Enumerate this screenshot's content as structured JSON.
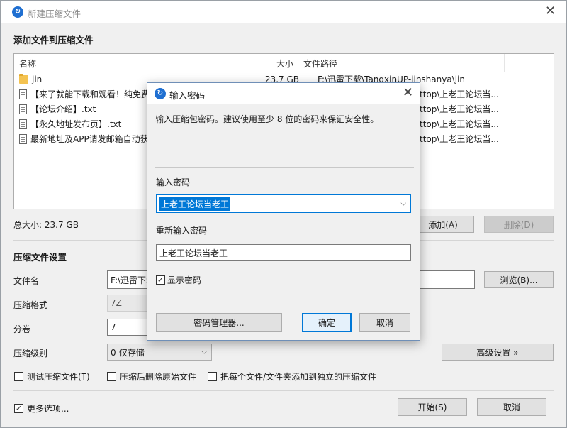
{
  "main": {
    "title": "新建压缩文件",
    "section_add": "添加文件到压缩文件",
    "list": {
      "columns": [
        "名称",
        "大小",
        "文件路径"
      ],
      "rows": [
        {
          "name": "jin",
          "size": "23.7 GB",
          "path": "F:\\迅雷下载\\TangxinUP-jinshanya\\jin",
          "icon": "folder-icon"
        },
        {
          "name": "【来了就能下载和观看！纯免费",
          "size": "",
          "path": "ttop\\上老王论坛当...",
          "icon": "text-file-icon"
        },
        {
          "name": "【论坛介绍】.txt",
          "size": "",
          "path": "ttop\\上老王论坛当...",
          "icon": "text-file-icon"
        },
        {
          "name": "【永久地址发布页】.txt",
          "size": "",
          "path": "ttop\\上老王论坛当...",
          "icon": "text-file-icon"
        },
        {
          "name": "最新地址及APP请发邮箱自动获",
          "size": "",
          "path": "ttop\\上老王论坛当...",
          "icon": "text-file-icon"
        }
      ]
    },
    "total_size": "总大小: 23.7 GB",
    "add_button": "添加(A)",
    "delete_button": "删除(D)",
    "section_settings": "压缩文件设置",
    "filename_label": "文件名",
    "filename_value": "F:\\迅雷下载",
    "browse_button": "浏览(B)...",
    "format_label": "压缩格式",
    "format_value": "7Z",
    "split_label": "分卷",
    "split_value": "7",
    "level_label": "压缩级别",
    "level_value": "0-仅存储",
    "advanced_button": "高级设置 »",
    "checkbox_test": "测试压缩文件(T)",
    "checkbox_delete_original": "压缩后删除原始文件",
    "checkbox_each_file": "把每个文件/文件夹添加到独立的压缩文件",
    "checkbox_more_options": "更多选项...",
    "start_button": "开始(S)",
    "cancel_button": "取消"
  },
  "dialog": {
    "title": "输入密码",
    "description": "输入压缩包密码。建议使用至少 8 位的密码来保证安全性。",
    "password_label": "输入密码",
    "password_value": "上老王论坛当老王",
    "reenter_label": "重新输入密码",
    "reenter_value": "上老王论坛当老王",
    "show_password_label": "显示密码",
    "password_manager_button": "密码管理器...",
    "ok_button": "确定",
    "cancel_button": "取消"
  },
  "colors": {
    "accent": "#0078d7",
    "selection": "#0078d7",
    "app_icon": "#1f6fd1"
  }
}
